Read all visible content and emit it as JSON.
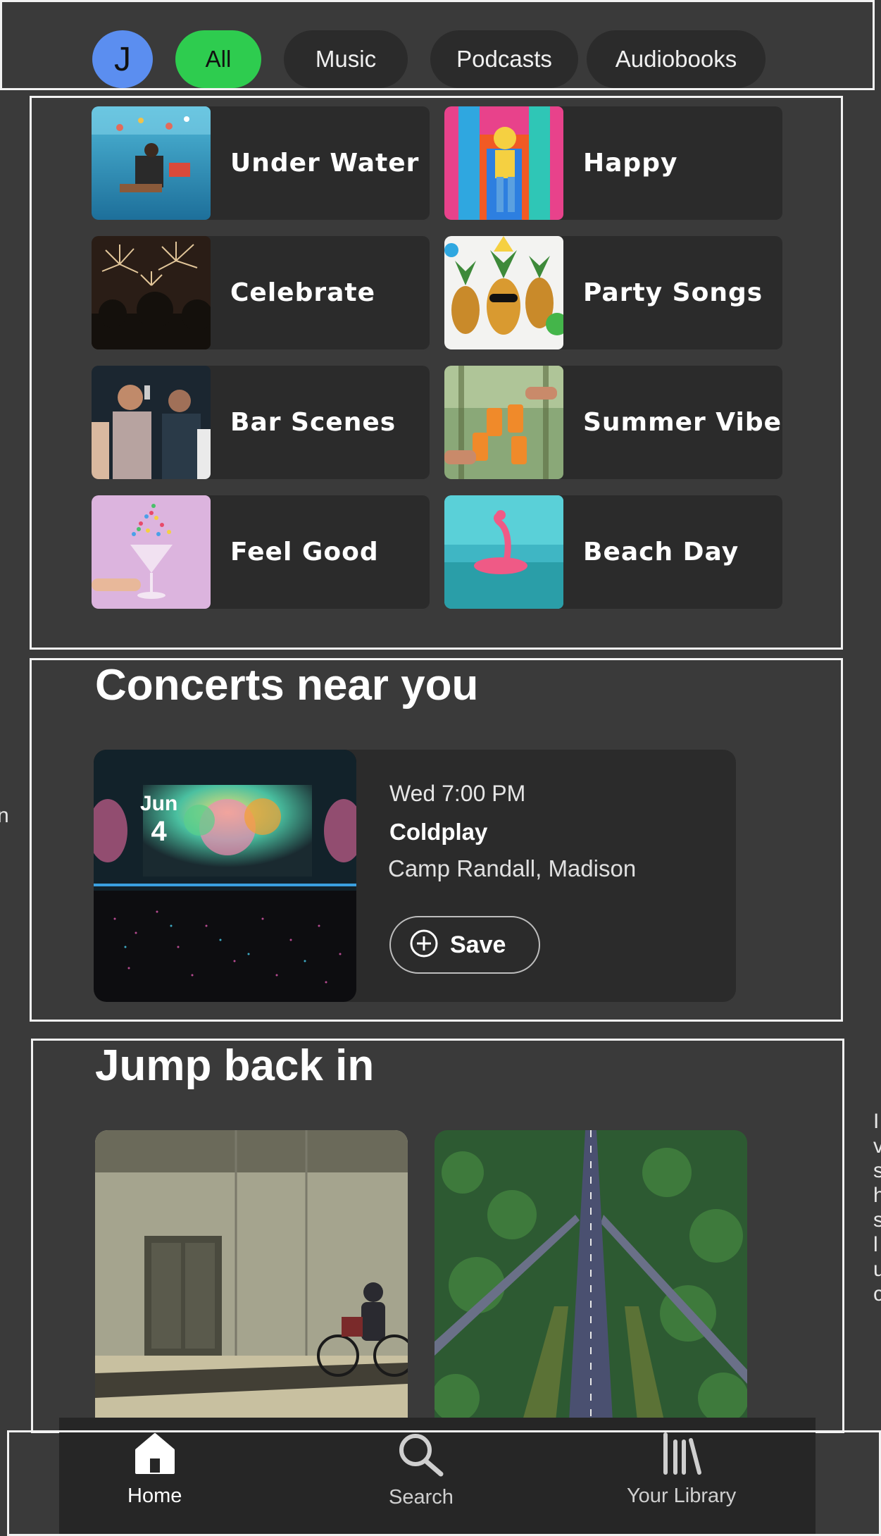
{
  "header": {
    "avatar_initial": "J",
    "chips": [
      {
        "label": "All",
        "active": true
      },
      {
        "label": "Music",
        "active": false
      },
      {
        "label": "Podcasts",
        "active": false
      },
      {
        "label": "Audiobooks",
        "active": false
      }
    ]
  },
  "tiles": [
    {
      "title": "Under Water",
      "image": "underwater-photo"
    },
    {
      "title": "Happy",
      "image": "colorful-wall-photo"
    },
    {
      "title": "Celebrate",
      "image": "fireworks-photo"
    },
    {
      "title": "Party Songs",
      "image": "pineapples-photo"
    },
    {
      "title": "Bar Scenes",
      "image": "bar-crowd-photo"
    },
    {
      "title": "Summer Vibe",
      "image": "cheers-drinks-photo"
    },
    {
      "title": "Feel Good",
      "image": "cocktail-sprinkles-photo"
    },
    {
      "title": "Beach Day",
      "image": "flamingo-float-photo"
    }
  ],
  "concerts": {
    "title": "Concerts near you",
    "card": {
      "month": "Jun",
      "day": "4",
      "when": "Wed 7:00 PM",
      "artist": "Coldplay",
      "venue": "Camp Randall, Madison",
      "save_label": "Save",
      "save_icon": "plus-circle-icon"
    }
  },
  "jump": {
    "title": "Jump back in",
    "items": [
      {
        "image": "street-cyclist-photo"
      },
      {
        "image": "forest-highway-photo"
      }
    ]
  },
  "edge_text": {
    "left": "n",
    "right": [
      "I",
      "v",
      "s",
      "h",
      "s",
      "l",
      "u",
      "c"
    ]
  },
  "nav": {
    "items": [
      {
        "label": "Home",
        "icon": "home-icon",
        "active": true
      },
      {
        "label": "Search",
        "icon": "search-icon",
        "active": false
      },
      {
        "label": "Your Library",
        "icon": "library-icon",
        "active": false
      }
    ]
  },
  "colors": {
    "background": "#3a3a3a",
    "card": "#2b2b2b",
    "accent_green": "#2ecc4f",
    "avatar_blue": "#5b8ef0"
  }
}
